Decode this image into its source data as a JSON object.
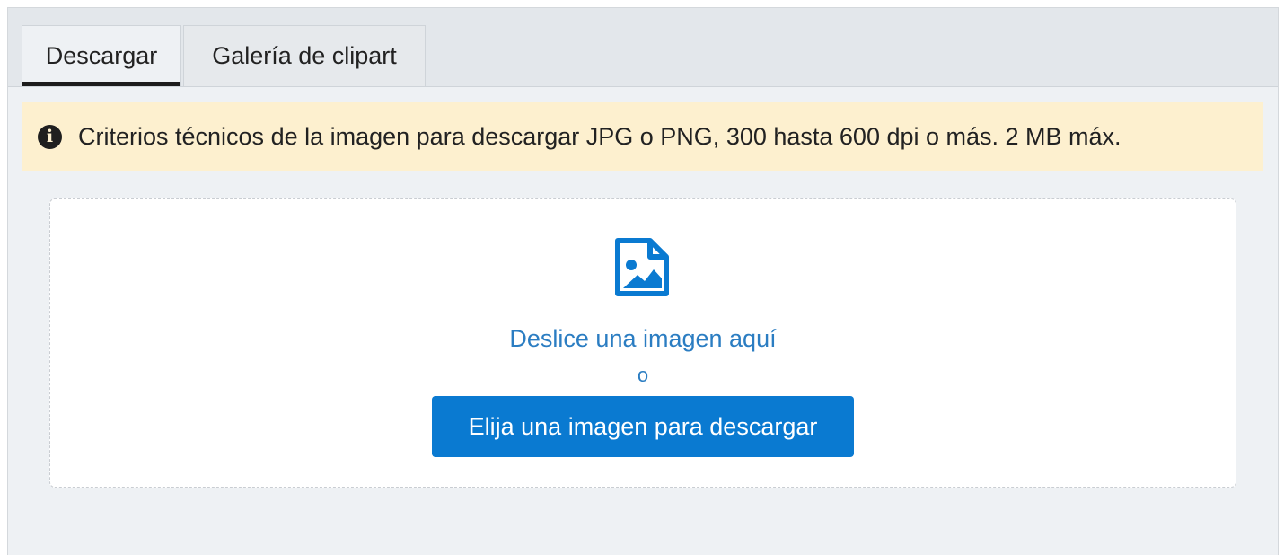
{
  "tabs": [
    {
      "label": "Descargar",
      "active": true
    },
    {
      "label": "Galería de clipart",
      "active": false
    }
  ],
  "notice": {
    "icon": "info-circle-icon",
    "text": "Criterios técnicos de la imagen para descargar JPG o PNG, 300 hasta 600 dpi o más. 2 MB máx."
  },
  "dropzone": {
    "icon": "image-file-icon",
    "drop_text": "Deslice una imagen aquí",
    "or_text": "o",
    "button_label": "Elija una imagen para descargar"
  },
  "colors": {
    "accent": "#0a7ad1",
    "link_text": "#2b7dc2",
    "notice_bg": "#fdf0cf"
  }
}
